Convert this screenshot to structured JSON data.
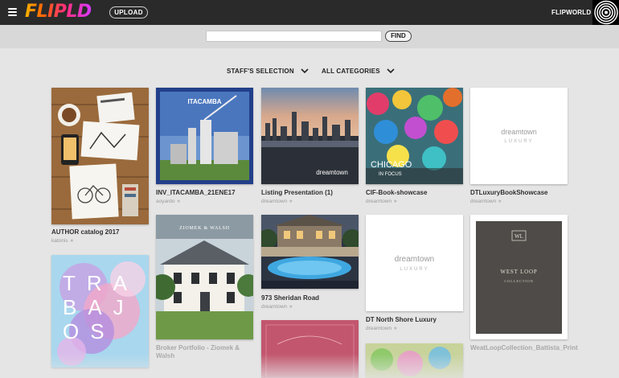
{
  "header": {
    "logo_text": "FLIPLD",
    "upload_label": "UPLOAD",
    "user_label": "FLIPWORLD"
  },
  "search": {
    "value": "",
    "placeholder": "",
    "find_label": "FIND"
  },
  "filters": {
    "selection_label": "STAFF'S SELECTION",
    "category_label": "ALL CATEGORIES"
  },
  "cards": [
    {
      "title": "AUTHOR catalog 2017",
      "author": "katonis"
    },
    {
      "title": "INV_ITACAMBA_21ENE17",
      "author": "aoyardo",
      "cover_text": "ITACAMBA"
    },
    {
      "title": "Listing Presentation (1)",
      "author": "dreamtown",
      "cover_text": "dreamtown"
    },
    {
      "title": "CIF-Book-showcase",
      "author": "dreamtown",
      "cover_text": "CHICAGO",
      "cover_subtext": "IN FOCUS"
    },
    {
      "title": "DTLuxuryBookShowcase",
      "author": "dreamtown",
      "cover_text": "dreamtown",
      "cover_subtext": "LUXURY"
    },
    {
      "title": "",
      "author": "",
      "cover_text": "TRABAJOS"
    },
    {
      "title": "Broker Portfolio - Ziomek & Walsh",
      "author": "",
      "cover_text": "ZIOMEK & WALSH"
    },
    {
      "title": "973 Sheridan Road",
      "author": "dreamtown"
    },
    {
      "title": "DT North Shore Luxury",
      "author": "dreamtown",
      "cover_text": "dreamtown",
      "cover_subtext": "LUXURY"
    },
    {
      "title": "WeatLoopCollection_Battista_Print",
      "author": "",
      "cover_text": "WEST LOOP",
      "cover_subtext": "COLLECTION",
      "badge": "WL"
    },
    {
      "title": "",
      "author": ""
    },
    {
      "title": "",
      "author": ""
    }
  ],
  "colors": {
    "topbar": "#2a2a2a",
    "background": "#e5e5e5",
    "logo_gradient_start": "#f7b500",
    "logo_gradient_end": "#d63aff"
  },
  "icons": {
    "menu": "hamburger-icon",
    "dropdown": "chevron-down-icon",
    "rating": "star-icon"
  }
}
